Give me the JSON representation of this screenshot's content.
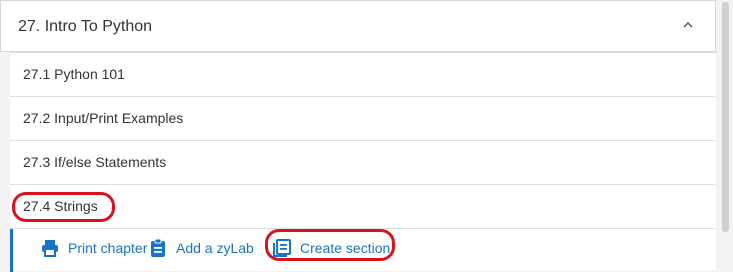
{
  "chapter": {
    "title": "27. Intro To Python",
    "expanded_icon": "chevron-up-icon"
  },
  "sections": [
    {
      "label": "27.1 Python 101",
      "highlighted": false
    },
    {
      "label": "27.2 Input/Print Examples",
      "highlighted": false
    },
    {
      "label": "27.3 If/else Statements",
      "highlighted": false
    },
    {
      "label": "27.4 Strings",
      "highlighted": true
    }
  ],
  "actions": {
    "print_chapter": {
      "label": "Print chapter",
      "icon": "printer-icon"
    },
    "add_zylab": {
      "label": "Add a zyLab",
      "icon": "clipboard-icon"
    },
    "create_section": {
      "label": "Create section",
      "icon": "document-list-icon",
      "highlighted": true
    }
  },
  "colors": {
    "accent": "#1a73c9",
    "highlight": "#d9131c"
  }
}
